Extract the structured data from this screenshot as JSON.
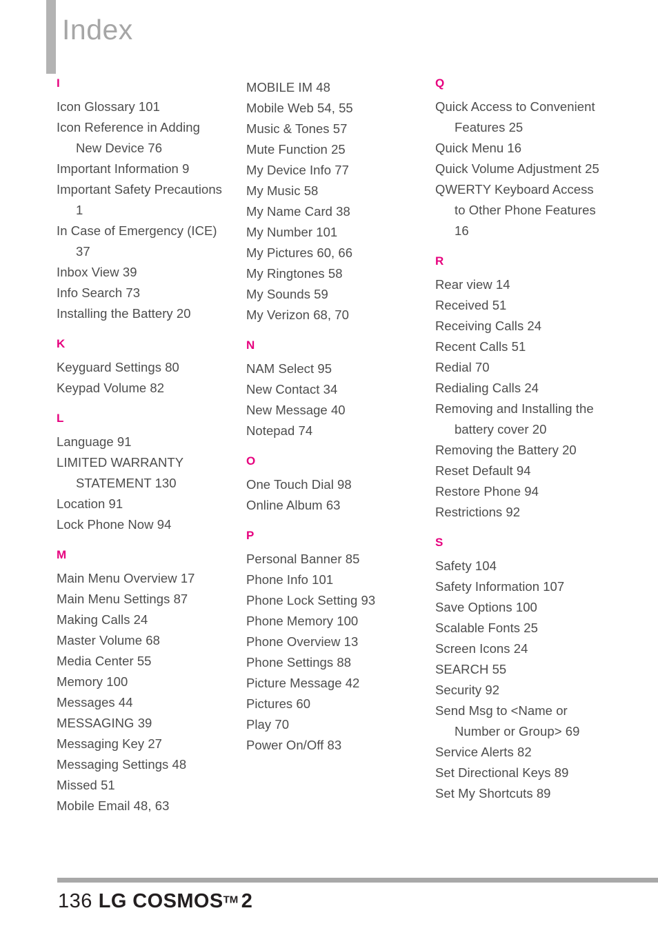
{
  "header": {
    "title": "Index"
  },
  "colors": {
    "section_letter": "#E6007E",
    "entry_text": "#4D4D4D",
    "header_bar": "#B3B3B3",
    "header_title": "#A6A6A6",
    "footer_rule": "#A8A8A8",
    "footer_text": "#231F20"
  },
  "columns": [
    {
      "id": "column-1",
      "sections": [
        {
          "letter": "I",
          "entries": [
            "Icon Glossary 101",
            "Icon Reference in Adding New Device 76",
            "Important Information 9",
            "Important Safety Precautions 1",
            "In Case of Emergency (ICE) 37",
            "Inbox View 39",
            "Info Search 73",
            "Installing the Battery 20"
          ]
        },
        {
          "letter": "K",
          "entries": [
            "Keyguard Settings 80",
            "Keypad Volume 82"
          ]
        },
        {
          "letter": "L",
          "entries": [
            "Language 91",
            "LIMITED WARRANTY STATEMENT 130",
            "Location 91",
            "Lock Phone Now 94"
          ]
        },
        {
          "letter": "M",
          "entries": [
            "Main Menu Overview 17",
            "Main Menu Settings 87",
            "Making Calls 24",
            "Master Volume 68",
            "Media Center 55",
            "Memory 100",
            "Messages 44",
            "MESSAGING 39",
            "Messaging Key 27",
            "Messaging Settings 48",
            "Missed 51",
            "Mobile Email 48, 63"
          ]
        }
      ]
    },
    {
      "id": "column-2",
      "continuation": [
        "MOBILE IM 48",
        "Mobile Web 54, 55",
        "Music & Tones 57",
        "Mute Function 25",
        "My Device Info 77",
        "My Music 58",
        "My Name Card 38",
        "My Number 101",
        "My Pictures 60, 66",
        "My Ringtones 58",
        "My Sounds 59",
        "My Verizon 68, 70"
      ],
      "sections": [
        {
          "letter": "N",
          "entries": [
            "NAM Select 95",
            "New Contact 34",
            "New Message 40",
            "Notepad 74"
          ]
        },
        {
          "letter": "O",
          "entries": [
            "One Touch Dial 98",
            "Online Album 63"
          ]
        },
        {
          "letter": "P",
          "entries": [
            "Personal Banner 85",
            "Phone Info 101",
            "Phone Lock Setting 93",
            "Phone Memory 100",
            "Phone Overview 13",
            "Phone Settings 88",
            "Picture Message 42",
            "Pictures 60",
            "Play 70",
            "Power On/Off 83"
          ]
        }
      ]
    },
    {
      "id": "column-3",
      "sections": [
        {
          "letter": "Q",
          "entries": [
            "Quick Access to Convenient Features 25",
            "Quick Menu 16",
            "Quick Volume Adjustment 25",
            "QWERTY Keyboard Access to Other Phone Features 16"
          ]
        },
        {
          "letter": "R",
          "entries": [
            "Rear view 14",
            "Received 51",
            "Receiving Calls 24",
            "Recent Calls 51",
            "Redial 70",
            "Redialing Calls 24",
            "Removing and Installing the battery cover 20",
            "Removing the Battery 20",
            "Reset Default 94",
            "Restore Phone 94",
            "Restrictions 92"
          ]
        },
        {
          "letter": "S",
          "entries": [
            "Safety 104",
            "Safety Information 107",
            "Save Options 100",
            "Scalable Fonts 25",
            "Screen Icons 24",
            "SEARCH 55",
            "Security 92",
            "Send Msg to <Name or Number or Group> 69",
            "Service Alerts 82",
            "Set Directional Keys 89",
            "Set My Shortcuts 89"
          ]
        }
      ]
    }
  ],
  "footer": {
    "page_number": "136",
    "brand": "LG COSMOS",
    "trademark": "TM",
    "model": "2"
  }
}
